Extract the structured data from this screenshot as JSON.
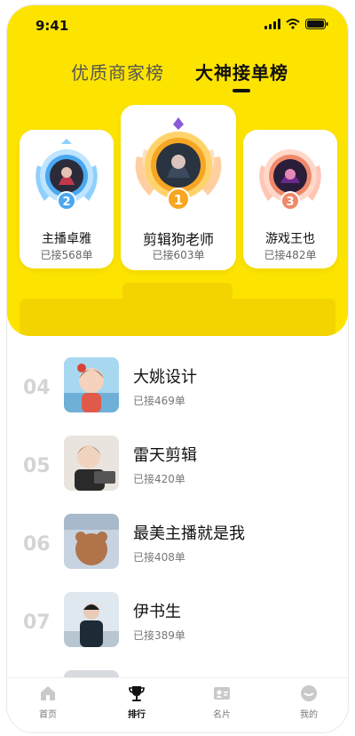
{
  "status_bar": {
    "time": "9:41"
  },
  "tabs": [
    {
      "label": "优质商家榜",
      "active": false
    },
    {
      "label": "大神接单榜",
      "active": true
    }
  ],
  "podium": [
    {
      "rank": "2",
      "name": "主播卓雅",
      "count": "已接568单",
      "badge_color": "#4aa8f0"
    },
    {
      "rank": "1",
      "name": "剪辑狗老师",
      "count": "已接603单",
      "badge_color": "#f6a623"
    },
    {
      "rank": "3",
      "name": "游戏王也",
      "count": "已接482单",
      "badge_color": "#f0896a"
    }
  ],
  "list": [
    {
      "rank": "04",
      "name": "大姚设计",
      "count": "已接469单"
    },
    {
      "rank": "05",
      "name": "雷天剪辑",
      "count": "已接420单"
    },
    {
      "rank": "06",
      "name": "最美主播就是我",
      "count": "已接408单"
    },
    {
      "rank": "07",
      "name": "伊书生",
      "count": "已接389单"
    }
  ],
  "bottom_nav": [
    {
      "label": "首页",
      "icon": "home-icon",
      "active": false
    },
    {
      "label": "排行",
      "icon": "trophy-icon",
      "active": true
    },
    {
      "label": "名片",
      "icon": "card-icon",
      "active": false
    },
    {
      "label": "我的",
      "icon": "profile-icon",
      "active": false
    }
  ],
  "colors": {
    "brand_yellow": "#fde400",
    "text_dark": "#111111",
    "text_gray": "#777777"
  }
}
